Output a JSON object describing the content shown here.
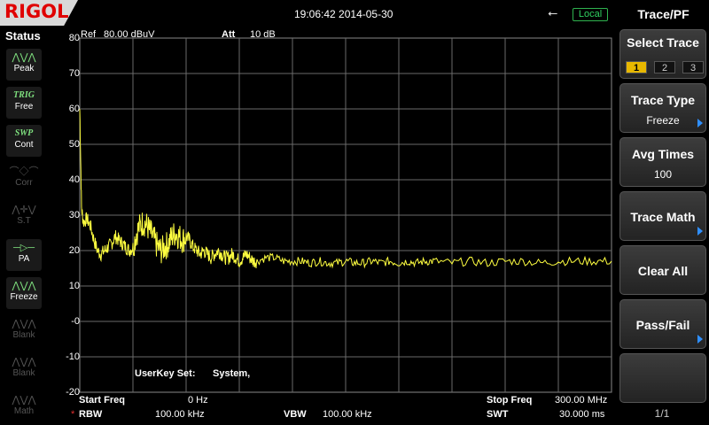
{
  "header": {
    "brand": "RIGOL",
    "datetime": "19:06:42 2014-05-30",
    "usb_icon": "usb-icon",
    "mode_badge": "Local"
  },
  "status_panel": {
    "title": "Status",
    "items": [
      {
        "icon": "peak-icon",
        "label": "Peak",
        "active": true
      },
      {
        "icon": "trig-text",
        "icon_text": "TRIG",
        "label": "Free",
        "active": true
      },
      {
        "icon": "swp-text",
        "icon_text": "SWP",
        "label": "Cont",
        "active": true
      },
      {
        "icon": "correction-icon",
        "label": "Corr",
        "active": false
      },
      {
        "icon": "signal-track-icon",
        "label": "S.T",
        "active": false
      },
      {
        "icon": "preamp-icon",
        "label": "PA",
        "active": true
      },
      {
        "icon": "freeze-icon",
        "label": "Freeze",
        "active": true
      },
      {
        "icon": "blank-icon",
        "label": "Blank",
        "active": false
      },
      {
        "icon": "blank-icon",
        "label": "Blank",
        "active": false
      },
      {
        "icon": "math-icon",
        "label": "Math",
        "active": false
      }
    ]
  },
  "display": {
    "ref_label": "Ref",
    "ref_value": "80.00 dBuV",
    "att_label": "Att",
    "att_value": "10 dB",
    "y_ticks": [
      "80",
      "70",
      "60",
      "50",
      "40",
      "30",
      "20",
      "10",
      "-0",
      "-10",
      "-20"
    ],
    "userkey_label": "UserKey Set:",
    "userkey_value": "System,",
    "start_freq_label": "Start Freq",
    "start_freq_value": "0 Hz",
    "stop_freq_label": "Stop Freq",
    "stop_freq_value": "300.00 MHz",
    "rbw_marker": "*",
    "rbw_label": "RBW",
    "rbw_value": "100.00 kHz",
    "vbw_label": "VBW",
    "vbw_value": "100.00 kHz",
    "swt_label": "SWT",
    "swt_value": "30.000 ms",
    "trace_color": "#ffff40",
    "grid_color": "#6a6a6a"
  },
  "chart_data": {
    "type": "line",
    "x_unit": "MHz",
    "xlim": [
      0,
      300
    ],
    "ylim": [
      -20,
      80
    ],
    "y_unit": "dBuV",
    "grid": true,
    "series": [
      {
        "color": "#ffff40",
        "x": [
          0,
          1,
          2,
          4,
          6,
          8,
          10,
          12,
          14,
          16,
          18,
          20,
          22,
          24,
          26,
          28,
          30,
          32,
          34,
          36,
          38,
          40,
          42,
          44,
          46,
          48,
          50,
          52,
          54,
          56,
          58,
          60,
          62,
          64,
          66,
          68,
          70,
          72,
          74,
          76,
          78,
          80,
          82,
          84,
          86,
          88,
          90,
          92,
          94,
          96,
          98,
          100,
          105,
          110,
          115,
          120,
          125,
          130,
          135,
          140,
          145,
          150,
          155,
          160,
          165,
          170,
          175,
          180,
          185,
          190,
          195,
          200,
          210,
          220,
          230,
          240,
          250,
          260,
          270,
          280,
          290,
          300
        ],
        "values": [
          60,
          32,
          28,
          29,
          27,
          23,
          20,
          19,
          20,
          21,
          22,
          24,
          23,
          22,
          21,
          20,
          21,
          25,
          27,
          28,
          27,
          25,
          23,
          21,
          20,
          21,
          22,
          24,
          25,
          24,
          23,
          24,
          23,
          21,
          20,
          19,
          20,
          19,
          18,
          19,
          20,
          19,
          18,
          18,
          19,
          18,
          17,
          18,
          19,
          18,
          17,
          17,
          18,
          18,
          17,
          17,
          17,
          16.5,
          17,
          16.5,
          16.5,
          17,
          16.5,
          16.5,
          17,
          16.5,
          17,
          16.5,
          17,
          16.5,
          17,
          17,
          16.5,
          17,
          16.5,
          17,
          17,
          16.5,
          17,
          17,
          17,
          17
        ]
      }
    ]
  },
  "right_menu": {
    "title": "Trace/PF",
    "select_trace_label": "Select Trace",
    "traces": [
      "1",
      "2",
      "3"
    ],
    "selected_trace": "1",
    "trace_type_label": "Trace Type",
    "trace_type_value": "Freeze",
    "avg_times_label": "Avg Times",
    "avg_times_value": "100",
    "trace_math_label": "Trace Math",
    "clear_all_label": "Clear All",
    "pass_fail_label": "Pass/Fail",
    "page": "1/1"
  }
}
